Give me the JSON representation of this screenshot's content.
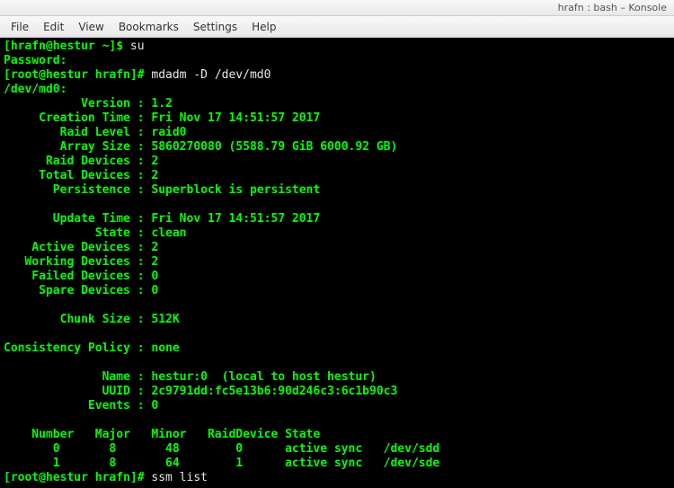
{
  "window": {
    "title": "hrafn : bash – Konsole"
  },
  "menu": {
    "file": "File",
    "edit": "Edit",
    "view": "View",
    "bookmarks": "Bookmarks",
    "settings": "Settings",
    "help": "Help"
  },
  "terminal": {
    "prompt1_user": "[hrafn@hestur ~]$ ",
    "cmd1": "su",
    "password_label": "Password:",
    "prompt2_root": "[root@hestur hrafn]# ",
    "cmd2": "mdadm -D /dev/md0",
    "device_header": "/dev/md0:",
    "fields": {
      "version_label": "           Version : ",
      "version_value": "1.2",
      "creation_label": "     Creation Time : ",
      "creation_value": "Fri Nov 17 14:51:57 2017",
      "raid_level_label": "        Raid Level : ",
      "raid_level_value": "raid0",
      "array_size_label": "        Array Size : ",
      "array_size_value": "5860270080 (5588.79 GiB 6000.92 GB)",
      "raid_devices_label": "      Raid Devices : ",
      "raid_devices_value": "2",
      "total_devices_label": "     Total Devices : ",
      "total_devices_value": "2",
      "persistence_label": "       Persistence : ",
      "persistence_value": "Superblock is persistent",
      "update_time_label": "       Update Time : ",
      "update_time_value": "Fri Nov 17 14:51:57 2017",
      "state_label": "             State : ",
      "state_value": "clean",
      "active_devices_label": "    Active Devices : ",
      "active_devices_value": "2",
      "working_devices_label": "   Working Devices : ",
      "working_devices_value": "2",
      "failed_devices_label": "    Failed Devices : ",
      "failed_devices_value": "0",
      "spare_devices_label": "     Spare Devices : ",
      "spare_devices_value": "0",
      "chunk_size_label": "        Chunk Size : ",
      "chunk_size_value": "512K",
      "consistency_label": "Consistency Policy : ",
      "consistency_value": "none",
      "name_label": "              Name : ",
      "name_value": "hestur:0  (local to host hestur)",
      "uuid_label": "              UUID : ",
      "uuid_value": "2c9791dd:fc5e13b6:90d246c3:6c1b90c3",
      "events_label": "            Events : ",
      "events_value": "0"
    },
    "table_header": "    Number   Major   Minor   RaidDevice State",
    "table_row0": "       0       8       48        0      active sync   /dev/sdd",
    "table_row1": "       1       8       64        1      active sync   /dev/sde",
    "prompt3_root": "[root@hestur hrafn]# ",
    "cmd3": "ssm list"
  }
}
